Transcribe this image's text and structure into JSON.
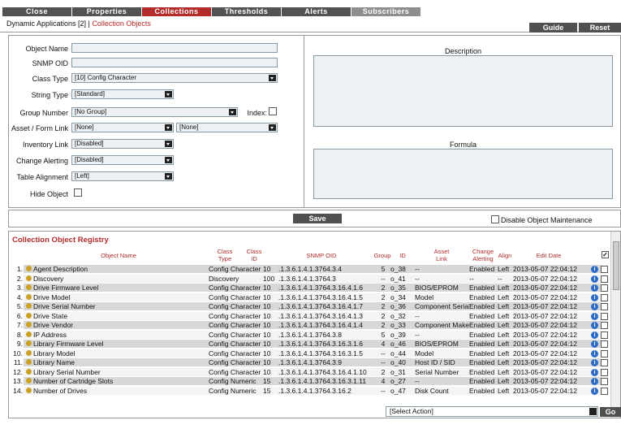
{
  "tabs": [
    "Close",
    "Properties",
    "Collections",
    "Thresholds",
    "Alerts",
    "Subscribers"
  ],
  "breadcrumb": {
    "prefix": "Dynamic Applications [2] | ",
    "current": "Collection Objects"
  },
  "header_buttons": {
    "guide": "Guide",
    "reset": "Reset"
  },
  "form": {
    "object_name_label": "Object Name",
    "object_name_value": "",
    "snmp_oid_label": "SNMP OID",
    "snmp_oid_value": "",
    "class_type_label": "Class Type",
    "class_type_value": "[10] Config Character",
    "string_type_label": "String Type",
    "string_type_value": "[Standard]",
    "group_number_label": "Group Number",
    "group_number_value": "[No Group]",
    "index_label": "Index:",
    "asset_form_link_label": "Asset / Form Link",
    "asset_link_value": "[None]",
    "form_link_value": "[None]",
    "inventory_link_label": "Inventory Link",
    "inventory_link_value": "[Disabled]",
    "change_alerting_label": "Change Alerting",
    "change_alerting_value": "[Disabled]",
    "table_alignment_label": "Table Alignment",
    "table_alignment_value": "[Left]",
    "hide_object_label": "Hide Object",
    "description_label": "Description",
    "formula_label": "Formula"
  },
  "save_label": "Save",
  "disable_maintenance_label": "Disable Object Maintenance",
  "registry": {
    "title": "Collection Object Registry",
    "columns": {
      "name": "Object Name",
      "class_type": "Class\nType",
      "class_id": "Class\nID",
      "oid": "SNMP OID",
      "group": "Group",
      "id": "ID",
      "asset": "Asset\nLink",
      "change": "Change\nAlerting",
      "align": "Align",
      "edit": "Edit Date"
    },
    "rows": [
      {
        "n": "1.",
        "name": "Agent Description",
        "ctype": "Config Character",
        "cid": "10",
        "oid": ".1.3.6.1.4.1.3764.3.4",
        "grp": "5",
        "id": "o_38",
        "asset": "--",
        "chg": "Enabled",
        "align": "Left",
        "date": "2013-05-07 22:04:12"
      },
      {
        "n": "2.",
        "name": "Discovery",
        "ctype": "Discovery",
        "cid": "100",
        "oid": ".1.3.6.1.4.1.3764.3",
        "grp": "--",
        "id": "o_41",
        "asset": "--",
        "chg": "--",
        "align": "--",
        "date": "2013-05-07 22:04:12"
      },
      {
        "n": "3.",
        "name": "Drive Firmware Level",
        "ctype": "Config Character",
        "cid": "10",
        "oid": ".1.3.6.1.4.1.3764.3.16.4.1.6",
        "grp": "2",
        "id": "o_35",
        "asset": "BIOS/EPROM",
        "chg": "Enabled",
        "align": "Left",
        "date": "2013-05-07 22:04:12"
      },
      {
        "n": "4.",
        "name": "Drive Model",
        "ctype": "Config Character",
        "cid": "10",
        "oid": ".1.3.6.1.4.1.3764.3.16.4.1.5",
        "grp": "2",
        "id": "o_34",
        "asset": "Model",
        "chg": "Enabled",
        "align": "Left",
        "date": "2013-05-07 22:04:12"
      },
      {
        "n": "5.",
        "name": "Drive Serial Number",
        "ctype": "Config Character",
        "cid": "10",
        "oid": ".1.3.6.1.4.1.3764.3.16.4.1.7",
        "grp": "2",
        "id": "o_36",
        "asset": "Component Serial",
        "chg": "Enabled",
        "align": "Left",
        "date": "2013-05-07 22:04:12"
      },
      {
        "n": "6.",
        "name": "Drive State",
        "ctype": "Config Character",
        "cid": "10",
        "oid": ".1.3.6.1.4.1.3764.3.16.4.1.3",
        "grp": "2",
        "id": "o_32",
        "asset": "--",
        "chg": "Enabled",
        "align": "Left",
        "date": "2013-05-07 22:04:12"
      },
      {
        "n": "7.",
        "name": "Drive Vendor",
        "ctype": "Config Character",
        "cid": "10",
        "oid": ".1.3.6.1.4.1.3764.3.16.4.1.4",
        "grp": "2",
        "id": "o_33",
        "asset": "Component Make",
        "chg": "Enabled",
        "align": "Left",
        "date": "2013-05-07 22:04:12"
      },
      {
        "n": "8.",
        "name": "IP Address",
        "ctype": "Config Character",
        "cid": "10",
        "oid": ".1.3.6.1.4.1.3764.3.8",
        "grp": "5",
        "id": "o_39",
        "asset": "--",
        "chg": "Enabled",
        "align": "Left",
        "date": "2013-05-07 22:04:12"
      },
      {
        "n": "9.",
        "name": "Library Firmware Level",
        "ctype": "Config Character",
        "cid": "10",
        "oid": ".1.3.6.1.4.1.3764.3.16.3.1.6",
        "grp": "4",
        "id": "o_46",
        "asset": "BIOS/EPROM",
        "chg": "Enabled",
        "align": "Left",
        "date": "2013-05-07 22:04:12"
      },
      {
        "n": "10.",
        "name": "Library Model",
        "ctype": "Config Character",
        "cid": "10",
        "oid": ".1.3.6.1.4.1.3764.3.16.3.1.5",
        "grp": "--",
        "id": "o_44",
        "asset": "Model",
        "chg": "Enabled",
        "align": "Left",
        "date": "2013-05-07 22:04:12"
      },
      {
        "n": "11.",
        "name": "Library Name",
        "ctype": "Config Character",
        "cid": "10",
        "oid": ".1.3.6.1.4.1.3764.3.9",
        "grp": "--",
        "id": "o_40",
        "asset": "Host ID / SID",
        "chg": "Enabled",
        "align": "Left",
        "date": "2013-05-07 22:04:12"
      },
      {
        "n": "12.",
        "name": "Library Serial Number",
        "ctype": "Config Character",
        "cid": "10",
        "oid": ".1.3.6.1.4.1.3764.3.16.4.1.10",
        "grp": "2",
        "id": "o_31",
        "asset": "Serial Number",
        "chg": "Enabled",
        "align": "Left",
        "date": "2013-05-07 22:04:12"
      },
      {
        "n": "13.",
        "name": "Number of Cartridge Slots",
        "ctype": "Config Numeric",
        "cid": "15",
        "oid": ".1.3.6.1.4.1.3764.3.16.3.1.11",
        "grp": "4",
        "id": "o_27",
        "asset": "--",
        "chg": "Enabled",
        "align": "Left",
        "date": "2013-05-07 22:04:12"
      },
      {
        "n": "14.",
        "name": "Number of Drives",
        "ctype": "Config Numeric",
        "cid": "15",
        "oid": ".1.3.6.1.4.1.3764.3.16.2",
        "grp": "--",
        "id": "o_47",
        "asset": "Disk Count",
        "chg": "Enabled",
        "align": "Left",
        "date": "2013-05-07 22:04:12"
      }
    ]
  },
  "action_select": "[Select Action]",
  "go_label": "Go",
  "info_glyph": "i",
  "icons": {
    "key": "key-icon",
    "info": "info-icon",
    "dropdown": "dropdown-arrow-icon"
  }
}
